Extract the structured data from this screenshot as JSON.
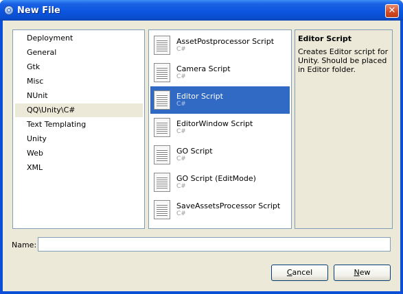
{
  "window": {
    "title": "New File",
    "close_symbol": "✕",
    "icon": "app-icon"
  },
  "categories": {
    "items": [
      {
        "label": "Deployment"
      },
      {
        "label": "General"
      },
      {
        "label": "Gtk"
      },
      {
        "label": "Misc"
      },
      {
        "label": "NUnit"
      },
      {
        "label": "QQ\\Unity\\C#",
        "selected": true
      },
      {
        "label": "Text Templating"
      },
      {
        "label": "Unity"
      },
      {
        "label": "Web"
      },
      {
        "label": "XML"
      }
    ]
  },
  "templates": {
    "items": [
      {
        "name": "AssetPostprocessor Script",
        "language": "C#"
      },
      {
        "name": "Camera Script",
        "language": "C#"
      },
      {
        "name": "Editor Script",
        "language": "C#",
        "selected": true
      },
      {
        "name": "EditorWindow Script",
        "language": "C#"
      },
      {
        "name": "GO Script",
        "language": "C#"
      },
      {
        "name": "GO Script (EditMode)",
        "language": "C#"
      },
      {
        "name": "SaveAssetsProcessor Script",
        "language": "C#"
      }
    ]
  },
  "description": {
    "title": "Editor Script",
    "text": "Creates Editor script for Unity. Should be placed in Editor folder."
  },
  "name_field": {
    "label": "Name:",
    "value": ""
  },
  "buttons": {
    "cancel_first": "C",
    "cancel_rest": "ancel",
    "new_first": "N",
    "new_rest": "ew"
  },
  "colors": {
    "titlebar": "#0a4fd6",
    "selection": "#316ac5",
    "dialog_bg": "#ece9d8"
  }
}
